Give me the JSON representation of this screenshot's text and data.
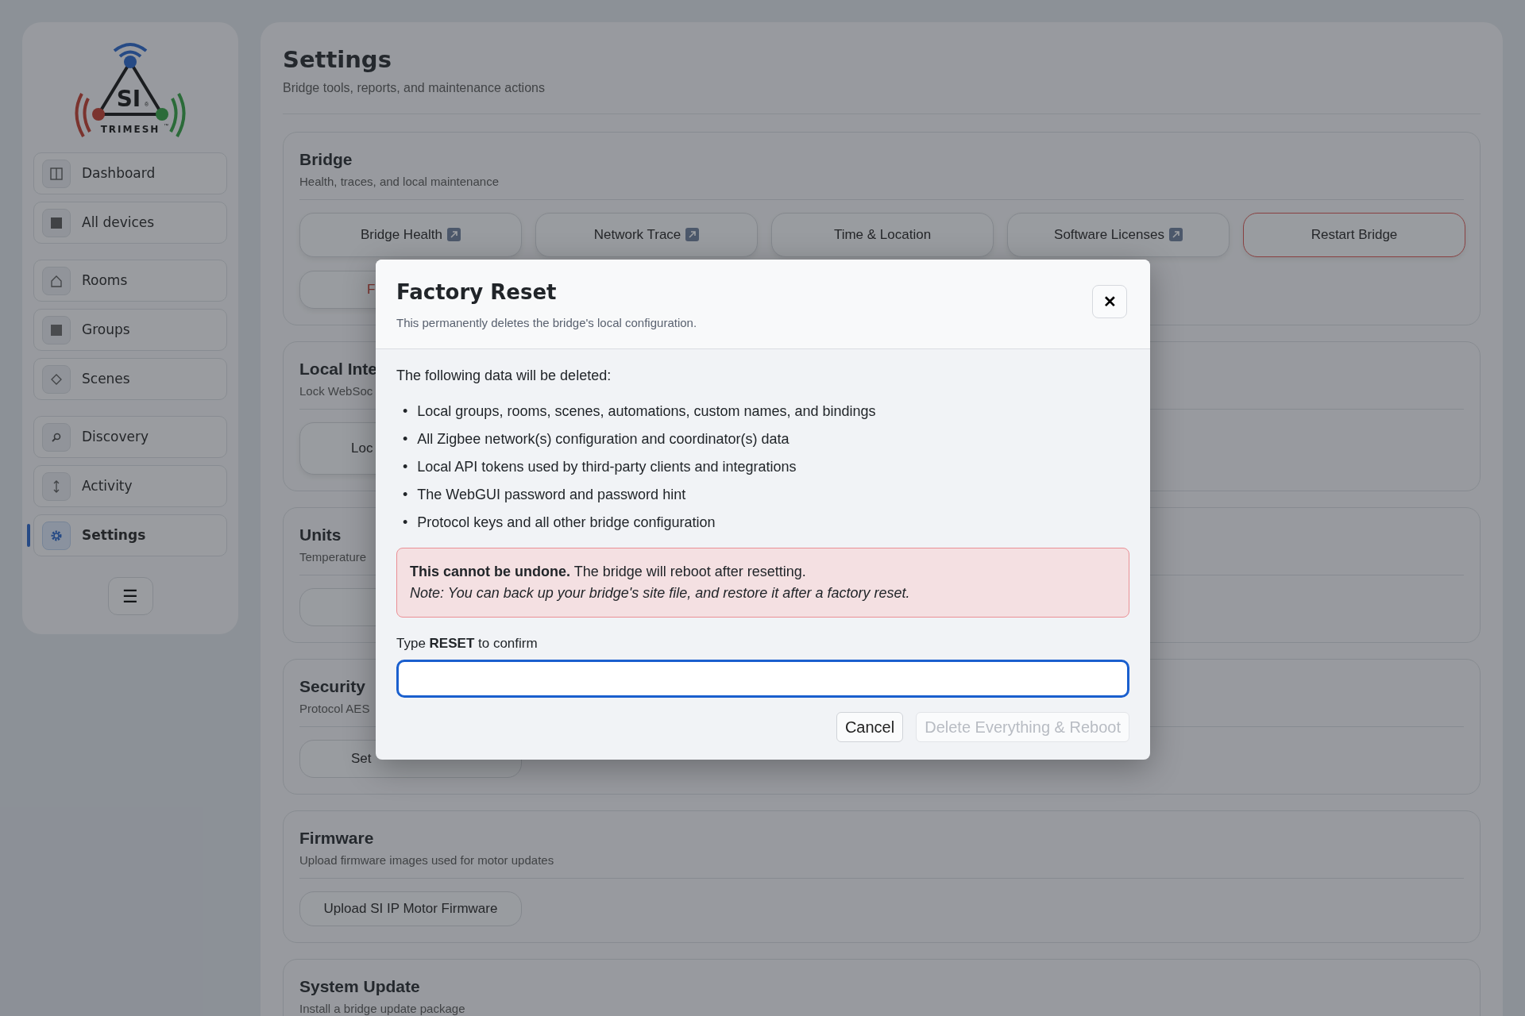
{
  "logo": {
    "mark": "SI",
    "reg": "®",
    "wordmark": "TRIMESH",
    "tm": "™"
  },
  "sidebar": {
    "groups": [
      [
        {
          "label": "Dashboard",
          "selected": false
        },
        {
          "label": "All devices",
          "selected": false
        }
      ],
      [
        {
          "label": "Rooms",
          "selected": false
        },
        {
          "label": "Groups",
          "selected": false
        },
        {
          "label": "Scenes",
          "selected": false
        }
      ],
      [
        {
          "label": "Discovery",
          "selected": false
        },
        {
          "label": "Activity",
          "selected": false
        },
        {
          "label": "Settings",
          "selected": true
        }
      ]
    ],
    "menu_button": "☰"
  },
  "page": {
    "title": "Settings",
    "subtitle": "Bridge tools, reports, and maintenance actions"
  },
  "sections": [
    {
      "title": "Bridge",
      "subtitle": "Health, traces, and local maintenance",
      "buttons": [
        {
          "label": "Bridge Health",
          "external": true,
          "kind": "tall"
        },
        {
          "label": "Network Trace",
          "external": true,
          "kind": "tall"
        },
        {
          "label": "Time & Location",
          "external": false,
          "kind": "tall"
        },
        {
          "label": "Software Licenses",
          "external": true,
          "kind": "tall"
        },
        {
          "label": "Restart Bridge",
          "external": false,
          "kind": "danger"
        },
        {
          "label": "F",
          "external": false,
          "kind": "danger-cut"
        }
      ]
    },
    {
      "title": "Local Inte",
      "subtitle": "Lock WebSoc",
      "buttons": [
        {
          "label": "Loc",
          "external": false,
          "kind": "raised-cut"
        }
      ]
    },
    {
      "title": "Units",
      "subtitle": "Temperature",
      "buttons": [
        {
          "external": false,
          "kind": "plain"
        }
      ]
    },
    {
      "title": "Security",
      "subtitle": "Protocol AES",
      "buttons": [
        {
          "label": "Set",
          "external": false,
          "kind": "cut"
        }
      ]
    },
    {
      "title": "Firmware",
      "subtitle": "Upload firmware images used for motor updates",
      "buttons": [
        {
          "label": "Upload SI IP Motor Firmware",
          "external": false,
          "kind": "small"
        }
      ]
    },
    {
      "title": "System Update",
      "subtitle": "Install a bridge update package"
    }
  ],
  "modal": {
    "title": "Factory Reset",
    "subtitle": "This permanently deletes the bridge's local configuration.",
    "close": "✕",
    "intro": "The following data will be deleted:",
    "bullet": "•",
    "items": [
      "Local groups, rooms, scenes, automations, custom names, and bindings",
      "All Zigbee network(s) configuration and coordinator(s) data",
      "Local API tokens used by third-party clients and integrations",
      "The WebGUI password and password hint",
      "Protocol keys and all other bridge configuration"
    ],
    "warning": "**This cannot be undone.** The bridge will reboot after resetting.",
    "note": "Note: You can back up your bridge's site file, and restore it after a factory reset.",
    "confirm_label": "Type **RESET** to confirm",
    "buttons": [
      {
        "label": "Cancel",
        "disabled": false
      },
      {
        "label": "Delete Everything & Reboot",
        "disabled": true
      }
    ]
  }
}
